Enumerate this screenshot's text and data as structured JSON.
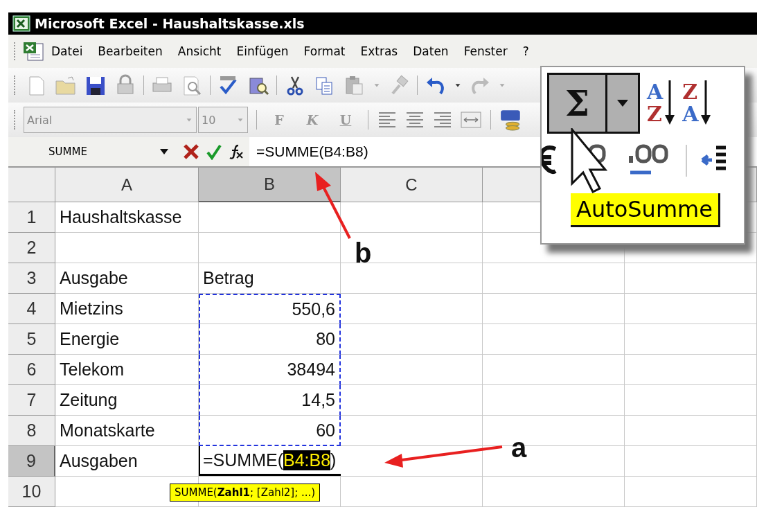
{
  "window": {
    "title": "Microsoft Excel - Haushaltskasse.xls"
  },
  "menu": [
    "Datei",
    "Bearbeiten",
    "Ansicht",
    "Einfügen",
    "Format",
    "Extras",
    "Daten",
    "Fenster",
    "?"
  ],
  "formatting_toolbar": {
    "font": "Arial",
    "size": "10",
    "style_buttons": [
      "F",
      "K",
      "U"
    ]
  },
  "formula_bar": {
    "name_box": "SUMME",
    "formula": "=SUMME(B4:B8)"
  },
  "sheet": {
    "columns": [
      {
        "label": "A",
        "selected": false
      },
      {
        "label": "B",
        "selected": true
      },
      {
        "label": "C",
        "selected": false
      }
    ],
    "rows": [
      {
        "header": "1",
        "selected": false,
        "marked": false,
        "cells": [
          {
            "kind": "text",
            "text": "Haushaltskasse"
          }
        ]
      },
      {
        "header": "2",
        "selected": false,
        "marked": false,
        "cells": []
      },
      {
        "header": "3",
        "selected": false,
        "marked": false,
        "cells": [
          {
            "kind": "text",
            "text": "Ausgabe"
          },
          {
            "kind": "text",
            "text": "Betrag"
          }
        ]
      },
      {
        "header": "4",
        "selected": false,
        "marked": true,
        "cells": [
          {
            "kind": "text",
            "text": "Mietzins"
          },
          {
            "kind": "number",
            "text": "550,6"
          }
        ]
      },
      {
        "header": "5",
        "selected": false,
        "marked": true,
        "cells": [
          {
            "kind": "text",
            "text": "Energie"
          },
          {
            "kind": "number",
            "text": "80"
          }
        ]
      },
      {
        "header": "6",
        "selected": false,
        "marked": true,
        "cells": [
          {
            "kind": "text",
            "text": "Telekom"
          },
          {
            "kind": "number",
            "text": "38494"
          }
        ]
      },
      {
        "header": "7",
        "selected": false,
        "marked": true,
        "cells": [
          {
            "kind": "text",
            "text": "Zeitung"
          },
          {
            "kind": "number",
            "text": "14,5"
          }
        ]
      },
      {
        "header": "8",
        "selected": false,
        "marked": true,
        "cells": [
          {
            "kind": "text",
            "text": "Monatskarte"
          },
          {
            "kind": "number",
            "text": "60"
          }
        ]
      },
      {
        "header": "9",
        "selected": true,
        "marked": false,
        "cells": [
          {
            "kind": "text",
            "text": "Ausgaben"
          },
          {
            "kind": "editing",
            "before": "=SUMME(",
            "reference": "B4:B8",
            "after": ")"
          }
        ]
      },
      {
        "header": "10",
        "selected": false,
        "marked": false,
        "cells": []
      }
    ],
    "function_tooltip": "SUMME(**Zahl1**; [Zahl2]; ...)"
  },
  "zoom_inset": {
    "button_symbol": "Σ",
    "sort_buttons": [
      {
        "top": "A",
        "bottom": "Z"
      },
      {
        "top": "Z",
        "bottom": "A"
      }
    ],
    "tooltip": "AutoSumme"
  },
  "annotations": [
    "b",
    "a"
  ]
}
